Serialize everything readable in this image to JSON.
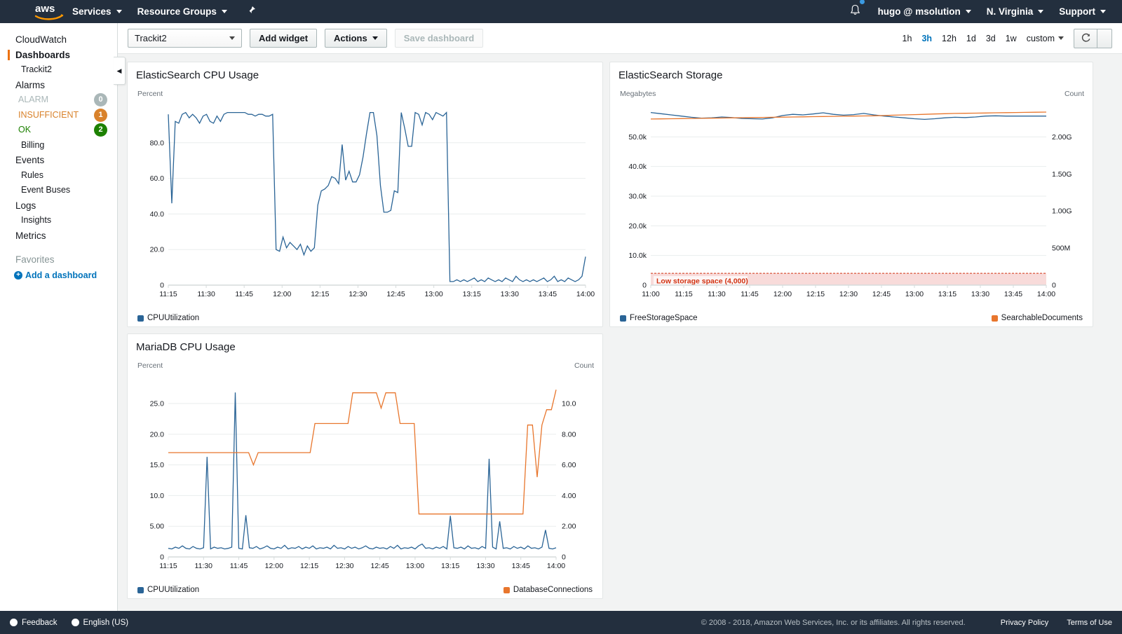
{
  "topnav": {
    "logo_alt": "aws",
    "items": [
      {
        "label": "Services",
        "caret": true
      },
      {
        "label": "Resource Groups",
        "caret": true
      }
    ],
    "pin_icon": "pin-icon",
    "bell_icon": "notifications-bell-icon",
    "account": "hugo @ msolution",
    "region": "N. Virginia",
    "support": "Support"
  },
  "sidebar": {
    "items": [
      {
        "label": "CloudWatch",
        "level": 0,
        "active": false
      },
      {
        "label": "Dashboards",
        "level": 0,
        "active": true
      },
      {
        "label": "Trackit2",
        "level": 1,
        "active": false
      },
      {
        "label": "Alarms",
        "level": 0,
        "active": false
      }
    ],
    "alarms": [
      {
        "label": "ALARM",
        "count": "0",
        "color": "#aab7b8",
        "badge": "#aab7b8"
      },
      {
        "label": "INSUFFICIENT",
        "count": "1",
        "color": "#d9822b",
        "badge": "#d9822b"
      },
      {
        "label": "OK",
        "count": "2",
        "color": "#1d8102",
        "badge": "#1d8102"
      }
    ],
    "items2": [
      {
        "label": "Billing",
        "level": 1
      },
      {
        "label": "Events",
        "level": 0
      },
      {
        "label": "Rules",
        "level": 1
      },
      {
        "label": "Event Buses",
        "level": 1
      },
      {
        "label": "Logs",
        "level": 0
      },
      {
        "label": "Insights",
        "level": 1
      },
      {
        "label": "Metrics",
        "level": 0
      }
    ],
    "favorites_label": "Favorites",
    "add_dashboard": "Add a dashboard",
    "collapse_icon": "collapse-sidebar-icon"
  },
  "toolbar": {
    "dashboard_select": "Trackit2",
    "add_widget": "Add widget",
    "actions": "Actions",
    "save_dashboard": "Save dashboard",
    "time_ranges": [
      "1h",
      "3h",
      "12h",
      "1d",
      "3d",
      "1w"
    ],
    "active_range": "3h",
    "custom_label": "custom",
    "refresh_icon": "refresh-icon",
    "refresh_caret_icon": "chevron-down-icon"
  },
  "chart_data": [
    {
      "type": "line",
      "title": "ElasticSearch CPU Usage",
      "ylabel": "Percent",
      "ylabel_right": "",
      "xlabel": "",
      "grid": true,
      "legend_position": "bottom-left",
      "ylim": [
        0,
        100
      ],
      "yticks": [
        "0",
        "20.0",
        "40.0",
        "60.0",
        "80.0"
      ],
      "ytick_values": [
        0,
        20,
        40,
        60,
        80
      ],
      "xticks": [
        "11:15",
        "11:30",
        "11:45",
        "12:00",
        "12:15",
        "12:30",
        "12:45",
        "13:00",
        "13:15",
        "13:30",
        "13:45",
        "14:00"
      ],
      "series": [
        {
          "name": "CPUUtilization",
          "color": "#2a6496",
          "axis": "left",
          "values": [
            96,
            46,
            92,
            91,
            96,
            97,
            94,
            96,
            94,
            91,
            95,
            96,
            92,
            91,
            95,
            92,
            96,
            97,
            97,
            97,
            97,
            97,
            97,
            96,
            96,
            95,
            96,
            96,
            95,
            95,
            96,
            20,
            19,
            27,
            21,
            24,
            22,
            20,
            23,
            17,
            22,
            19,
            21,
            45,
            53,
            54,
            56,
            61,
            60,
            57,
            79,
            59,
            64,
            58,
            58,
            62,
            72,
            85,
            97,
            97,
            84,
            56,
            41,
            41,
            42,
            53,
            52,
            97,
            88,
            78,
            78,
            97,
            96,
            90,
            97,
            96,
            93,
            97,
            96,
            95,
            97,
            2,
            2,
            3,
            2,
            3,
            2,
            3,
            4,
            2,
            3,
            2,
            4,
            3,
            2,
            3,
            2,
            4,
            3,
            2,
            5,
            3,
            2,
            3,
            2,
            3,
            2,
            3,
            4,
            2,
            3,
            5,
            2,
            3,
            2,
            4,
            3,
            2,
            3,
            5,
            16
          ]
        }
      ]
    },
    {
      "type": "line",
      "title": "ElasticSearch Storage",
      "ylabel": "Megabytes",
      "ylabel_right": "Count",
      "grid": true,
      "legend_position": "bottom-split",
      "ylim": [
        0,
        60000
      ],
      "yticks": [
        "0",
        "10.0k",
        "20.0k",
        "30.0k",
        "40.0k",
        "50.0k"
      ],
      "ytick_values": [
        0,
        10000,
        20000,
        30000,
        40000,
        50000
      ],
      "yticks_right": [
        "0",
        "500M",
        "1.00G",
        "1.50G",
        "2.00G"
      ],
      "ytick_right_values": [
        0,
        500000000,
        1000000000,
        1500000000,
        2000000000
      ],
      "ylim_right": [
        0,
        2400000000
      ],
      "xticks": [
        "11:00",
        "11:15",
        "11:30",
        "11:45",
        "12:00",
        "12:15",
        "12:30",
        "12:45",
        "13:00",
        "13:15",
        "13:30",
        "13:45",
        "14:00"
      ],
      "annotation": {
        "label": "Low storage space (4,000)",
        "value": 4000,
        "color": "#d13212",
        "band_color": "#f7d5d3"
      },
      "series": [
        {
          "name": "FreeStorageSpace",
          "color": "#2a6496",
          "axis": "left",
          "values": [
            58200,
            57800,
            57400,
            57000,
            56600,
            56300,
            56400,
            56700,
            56500,
            56200,
            56100,
            56000,
            56400,
            57200,
            57600,
            57400,
            57700,
            58100,
            57600,
            57300,
            57500,
            57900,
            57400,
            57000,
            56700,
            56400,
            56100,
            55900,
            56100,
            56400,
            56600,
            56500,
            56700,
            57000,
            57100,
            57000,
            57000,
            57000,
            57000,
            57000
          ]
        },
        {
          "name": "SearchableDocuments",
          "color": "#e8762d",
          "axis": "right",
          "values": [
            2240000000,
            2242000000,
            2244000000,
            2246000000,
            2248000000,
            2250000000,
            2252000000,
            2254000000,
            2256000000,
            2258000000,
            2260000000,
            2262000000,
            2264000000,
            2266000000,
            2268000000,
            2270000000,
            2272000000,
            2274000000,
            2276000000,
            2278000000,
            2280000000,
            2282000000,
            2284000000,
            2288000000,
            2292000000,
            2296000000,
            2300000000,
            2304000000,
            2308000000,
            2312000000,
            2316000000,
            2318000000,
            2320000000,
            2322000000,
            2324000000,
            2326000000,
            2328000000,
            2330000000,
            2332000000,
            2334000000
          ]
        }
      ]
    },
    {
      "type": "line",
      "title": "MariaDB CPU Usage",
      "ylabel": "Percent",
      "ylabel_right": "Count",
      "grid": true,
      "legend_position": "bottom-split",
      "ylim": [
        0,
        29
      ],
      "yticks": [
        "0",
        "5.00",
        "10.0",
        "15.0",
        "20.0",
        "25.0"
      ],
      "ytick_values": [
        0,
        5,
        10,
        15,
        20,
        25
      ],
      "yticks_right": [
        "0",
        "2.00",
        "4.00",
        "6.00",
        "8.00",
        "10.0"
      ],
      "ytick_right_values": [
        0,
        2,
        4,
        6,
        8,
        10
      ],
      "ylim_right": [
        0,
        11.6
      ],
      "xticks": [
        "11:15",
        "11:30",
        "11:45",
        "12:00",
        "12:15",
        "12:30",
        "12:45",
        "13:00",
        "13:15",
        "13:30",
        "13:45",
        "14:00"
      ],
      "series": [
        {
          "name": "CPUUtilization",
          "color": "#2a6496",
          "axis": "left",
          "values": [
            1.4,
            1.3,
            1.6,
            1.4,
            1.8,
            1.4,
            1.3,
            1.7,
            1.4,
            1.3,
            1.5,
            16.3,
            1.3,
            1.6,
            1.4,
            1.5,
            1.3,
            1.4,
            1.6,
            26.8,
            1.4,
            1.3,
            6.8,
            1.5,
            1.4,
            1.7,
            1.3,
            1.5,
            1.8,
            1.4,
            1.3,
            1.6,
            1.4,
            1.9,
            1.3,
            1.5,
            1.4,
            1.7,
            1.3,
            1.6,
            1.4,
            1.8,
            1.3,
            1.5,
            1.4,
            1.6,
            1.3,
            1.9,
            1.4,
            1.5,
            1.3,
            1.7,
            1.4,
            1.6,
            1.3,
            1.5,
            1.8,
            1.4,
            1.3,
            1.6,
            1.4,
            1.5,
            1.3,
            1.7,
            1.4,
            1.9,
            1.3,
            1.5,
            1.4,
            1.6,
            1.3,
            1.8,
            2.1,
            1.4,
            1.5,
            1.3,
            1.6,
            1.4,
            1.7,
            1.3,
            6.7,
            1.5,
            1.4,
            1.6,
            1.3,
            1.8,
            1.4,
            1.5,
            1.3,
            1.7,
            1.4,
            16.0,
            1.6,
            1.3,
            5.8,
            1.4,
            1.5,
            1.3,
            1.7,
            1.4,
            1.6,
            1.3,
            1.8,
            1.4,
            1.5,
            1.3,
            1.6,
            4.4,
            1.4,
            1.3,
            1.5
          ]
        },
        {
          "name": "DatabaseConnections",
          "color": "#e8762d",
          "axis": "right",
          "values": [
            6.8,
            6.8,
            6.8,
            6.8,
            6.8,
            6.8,
            6.8,
            6.8,
            6.8,
            6.8,
            6.8,
            6.8,
            6.8,
            6.8,
            6.8,
            6.8,
            6.8,
            6.8,
            6.0,
            6.8,
            6.8,
            6.8,
            6.8,
            6.8,
            6.8,
            6.8,
            6.8,
            6.8,
            6.8,
            6.8,
            6.8,
            8.7,
            8.7,
            8.7,
            8.7,
            8.7,
            8.7,
            8.7,
            8.7,
            10.7,
            10.7,
            10.7,
            10.7,
            10.7,
            10.7,
            9.7,
            10.7,
            10.7,
            10.7,
            8.7,
            8.7,
            8.7,
            8.7,
            2.8,
            2.8,
            2.8,
            2.8,
            2.8,
            2.8,
            2.8,
            2.8,
            2.8,
            2.8,
            2.8,
            2.8,
            2.8,
            2.8,
            2.8,
            2.8,
            2.8,
            2.8,
            2.8,
            2.8,
            2.8,
            2.8,
            2.8,
            8.6,
            8.6,
            5.2,
            8.6,
            9.6,
            9.6,
            10.9
          ]
        }
      ]
    }
  ],
  "footer": {
    "feedback": "Feedback",
    "language": "English (US)",
    "copyright": "© 2008 - 2018, Amazon Web Services, Inc. or its affiliates. All rights reserved.",
    "privacy": "Privacy Policy",
    "terms": "Terms of Use"
  }
}
